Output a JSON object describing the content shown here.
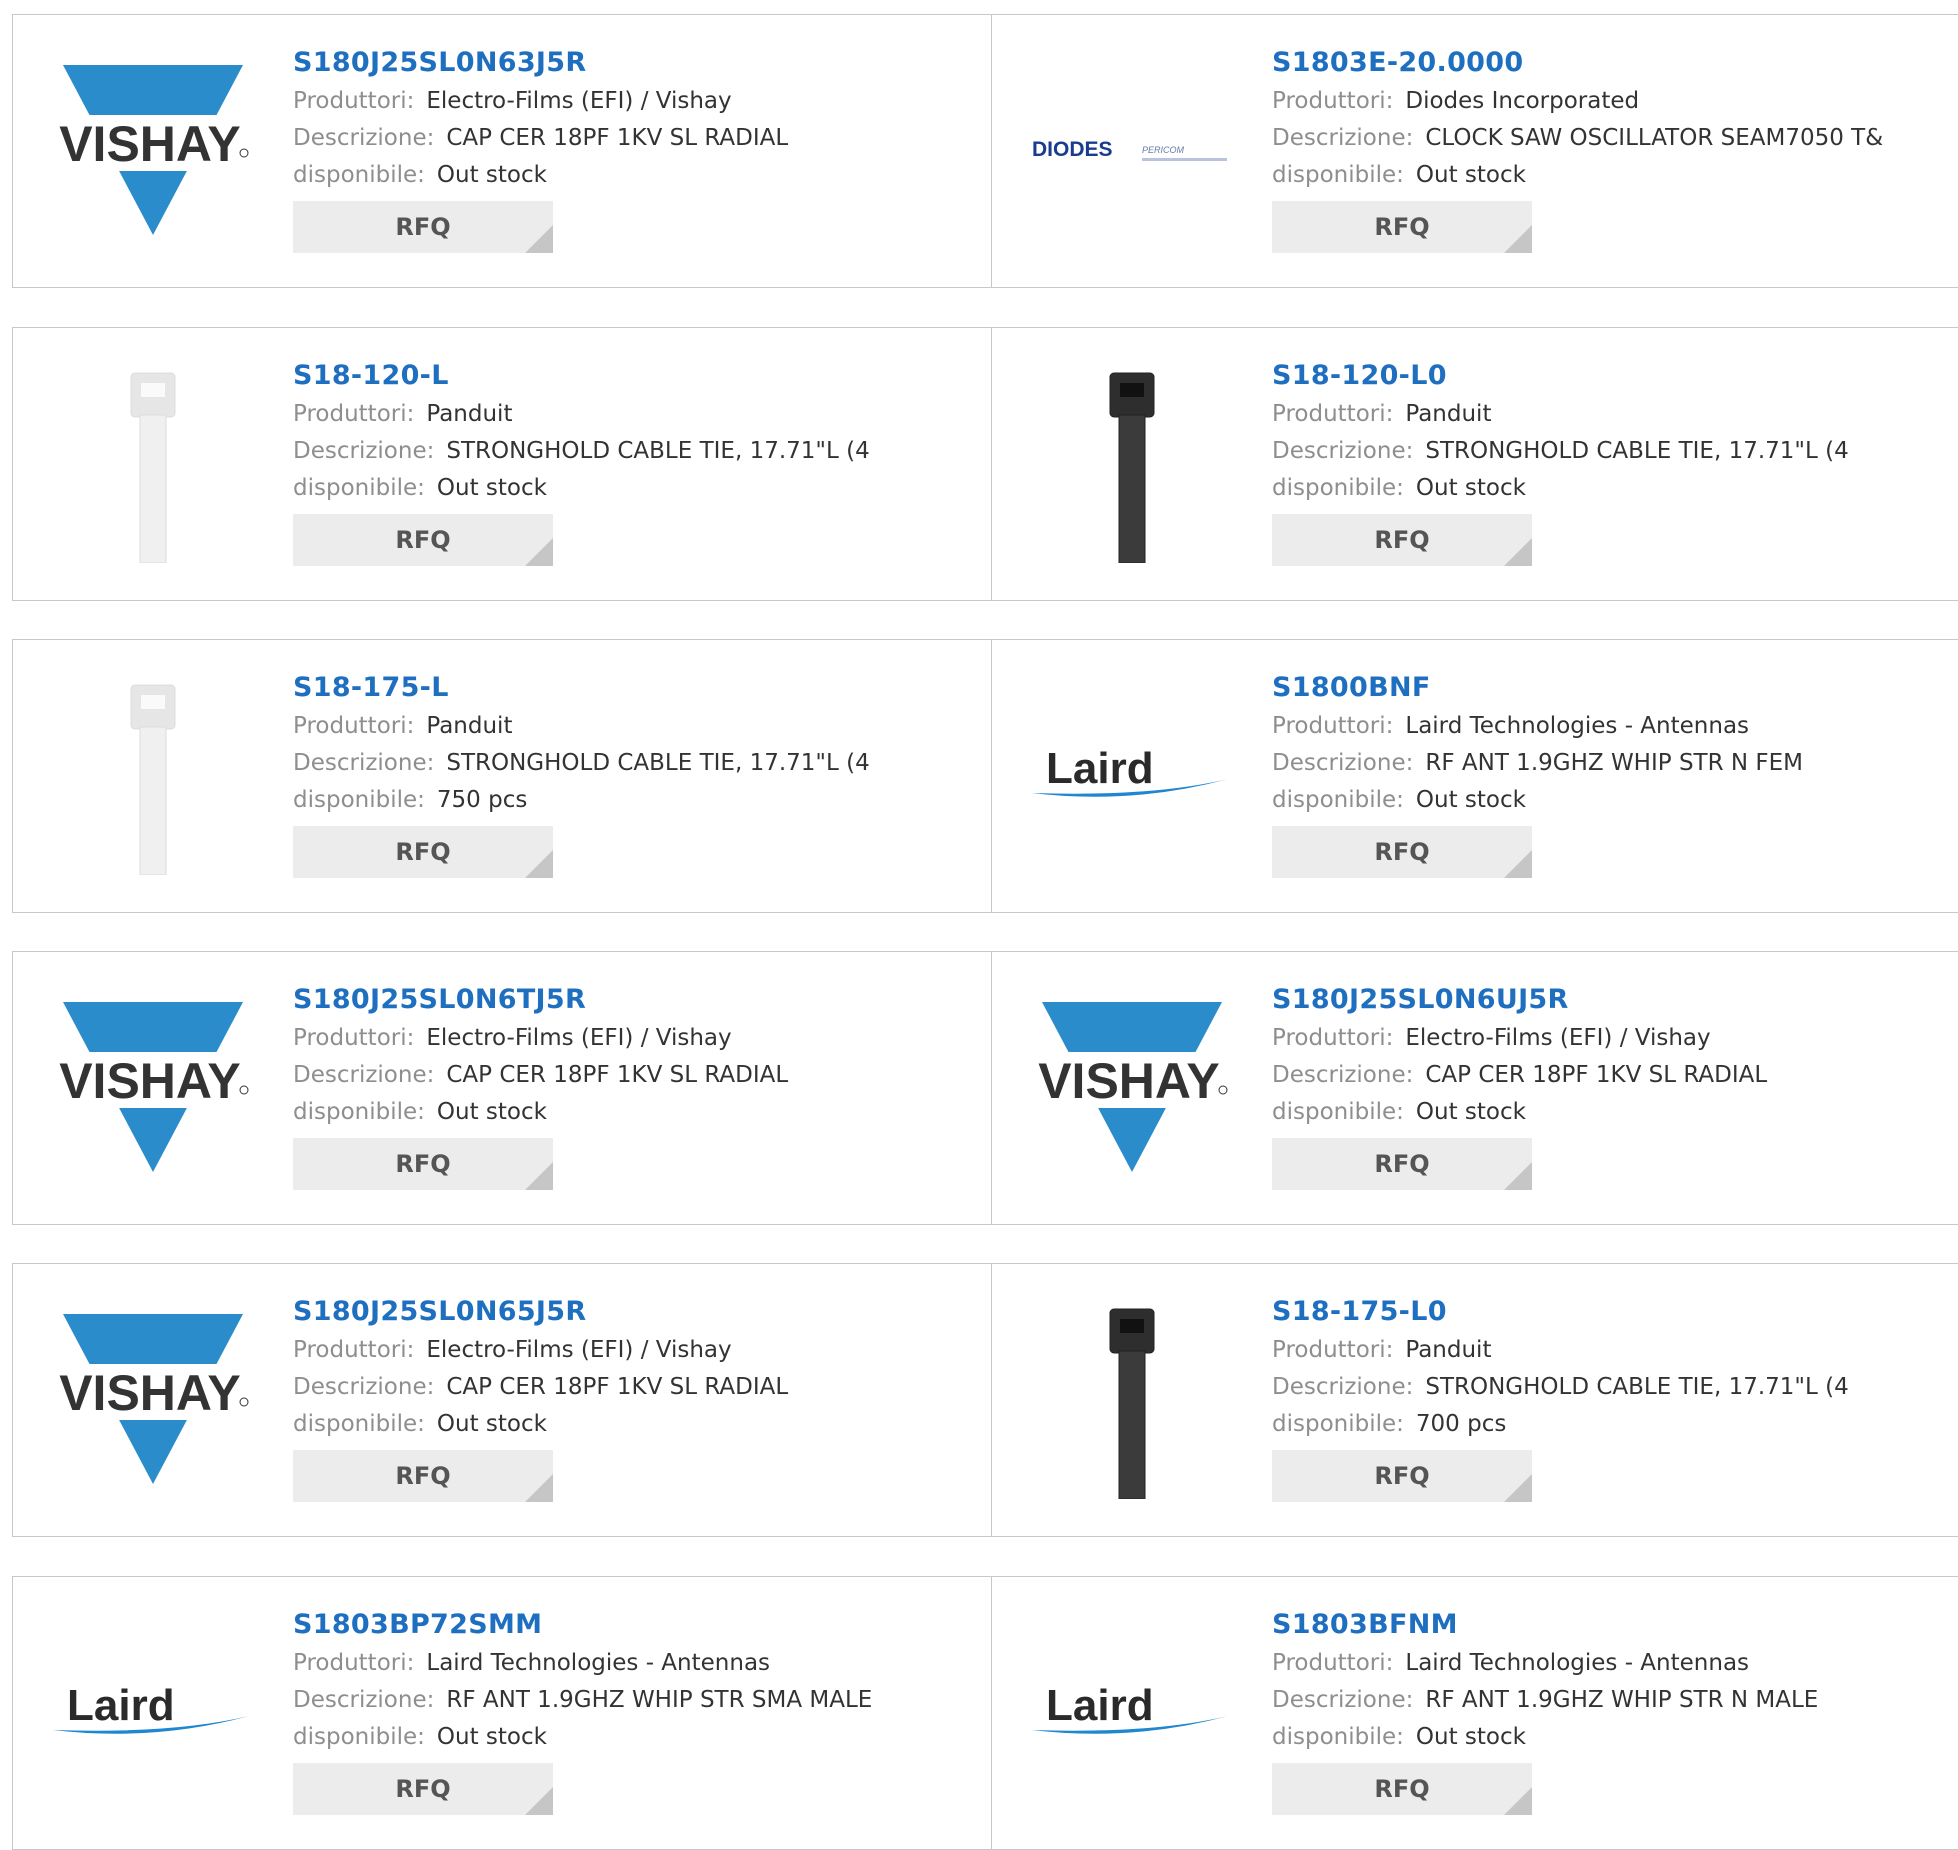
{
  "labels": {
    "manufacturer": "Produttori:",
    "description": "Descrizione:",
    "availability": "disponibile:",
    "rfq": "RFQ"
  },
  "rows": [
    [
      {
        "part": "S180J25SL0N63J5R",
        "logo": "vishay-logo",
        "manufacturer": "Electro-Films (EFI) / Vishay",
        "description": "CAP CER 18PF 1KV SL RADIAL",
        "availability": "Out stock"
      },
      {
        "part": "S1803E-20.0000",
        "logo": "diodes-logo",
        "manufacturer": "Diodes Incorporated",
        "description": "CLOCK SAW OSCILLATOR SEAM7050 T&",
        "availability": "Out stock"
      }
    ],
    [
      {
        "part": "S18-120-L",
        "logo": "cable-tie-natural-image",
        "manufacturer": "Panduit",
        "description": "STRONGHOLD CABLE TIE, 17.71\"L (4",
        "availability": "Out stock"
      },
      {
        "part": "S18-120-L0",
        "logo": "cable-tie-black-image",
        "manufacturer": "Panduit",
        "description": "STRONGHOLD CABLE TIE, 17.71\"L (4",
        "availability": "Out stock"
      }
    ],
    [
      {
        "part": "S18-175-L",
        "logo": "cable-tie-natural-image",
        "manufacturer": "Panduit",
        "description": "STRONGHOLD CABLE TIE, 17.71\"L (4",
        "availability": "750 pcs"
      },
      {
        "part": "S1800BNF",
        "logo": "laird-logo",
        "manufacturer": "Laird Technologies - Antennas",
        "description": "RF ANT 1.9GHZ WHIP STR N FEM",
        "availability": "Out stock"
      }
    ],
    [
      {
        "part": "S180J25SL0N6TJ5R",
        "logo": "vishay-logo",
        "manufacturer": "Electro-Films (EFI) / Vishay",
        "description": "CAP CER 18PF 1KV SL RADIAL",
        "availability": "Out stock"
      },
      {
        "part": "S180J25SL0N6UJ5R",
        "logo": "vishay-logo",
        "manufacturer": "Electro-Films (EFI) / Vishay",
        "description": "CAP CER 18PF 1KV SL RADIAL",
        "availability": "Out stock"
      }
    ],
    [
      {
        "part": "S180J25SL0N65J5R",
        "logo": "vishay-logo",
        "manufacturer": "Electro-Films (EFI) / Vishay",
        "description": "CAP CER 18PF 1KV SL RADIAL",
        "availability": "Out stock"
      },
      {
        "part": "S18-175-L0",
        "logo": "cable-tie-black-image",
        "manufacturer": "Panduit",
        "description": "STRONGHOLD CABLE TIE, 17.71\"L (4",
        "availability": "700 pcs"
      }
    ],
    [
      {
        "part": "S1803BP72SMM",
        "logo": "laird-logo",
        "manufacturer": "Laird Technologies - Antennas",
        "description": "RF ANT 1.9GHZ WHIP STR SMA MALE",
        "availability": "Out stock"
      },
      {
        "part": "S1803BFNM",
        "logo": "laird-logo",
        "manufacturer": "Laird Technologies - Antennas",
        "description": "RF ANT 1.9GHZ WHIP STR N MALE",
        "availability": "Out stock"
      }
    ]
  ],
  "brand": {
    "vishay": {
      "text": "VISHAY",
      "color": "#2a8ccb"
    },
    "diodes": {
      "text": "DIODES",
      "sub": "PERICOM",
      "color": "#1a3c8c"
    },
    "laird": {
      "text": "Laird",
      "color": "#2a2a2a",
      "swoosh": "#1f86d1"
    }
  },
  "colors": {
    "link": "#1f6fc0",
    "label": "#8e8e8e",
    "rfq_bg": "#ececec"
  }
}
